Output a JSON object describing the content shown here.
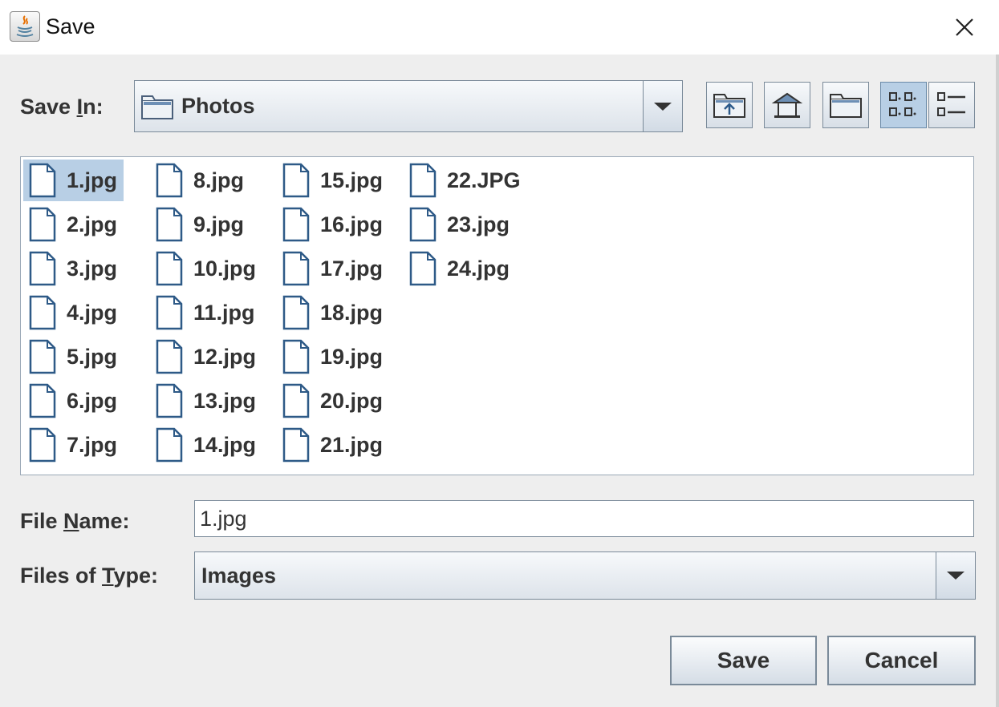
{
  "window": {
    "title": "Save",
    "app_icon": "java-icon",
    "close_icon": "close-icon"
  },
  "save_in": {
    "label_pre": "Save ",
    "label_mnemonic": "I",
    "label_post": "n:",
    "value": "Photos",
    "icon": "folder-icon"
  },
  "toolbar": [
    {
      "name": "up-one-level-button",
      "icon": "folder-up-icon"
    },
    {
      "name": "home-button",
      "icon": "home-icon"
    },
    {
      "name": "new-folder-button",
      "icon": "new-folder-icon"
    },
    {
      "name": "list-view-button",
      "icon": "list-view-icon",
      "active": true
    },
    {
      "name": "details-view-button",
      "icon": "details-view-icon"
    }
  ],
  "files": [
    [
      "1.jpg",
      "2.jpg",
      "3.jpg",
      "4.jpg",
      "5.jpg",
      "6.jpg",
      "7.jpg"
    ],
    [
      "8.jpg",
      "9.jpg",
      "10.jpg",
      "11.jpg",
      "12.jpg",
      "13.jpg",
      "14.jpg"
    ],
    [
      "15.jpg",
      "16.jpg",
      "17.jpg",
      "18.jpg",
      "19.jpg",
      "20.jpg",
      "21.jpg"
    ],
    [
      "22.JPG",
      "23.jpg",
      "24.jpg"
    ]
  ],
  "selected_file": "1.jpg",
  "file_name": {
    "label_pre": "File ",
    "label_mnemonic": "N",
    "label_post": "ame:",
    "value": "1.jpg"
  },
  "file_type": {
    "label_pre": "Files of ",
    "label_mnemonic": "T",
    "label_post": "ype:",
    "value": "Images"
  },
  "buttons": {
    "save": "Save",
    "cancel": "Cancel"
  }
}
